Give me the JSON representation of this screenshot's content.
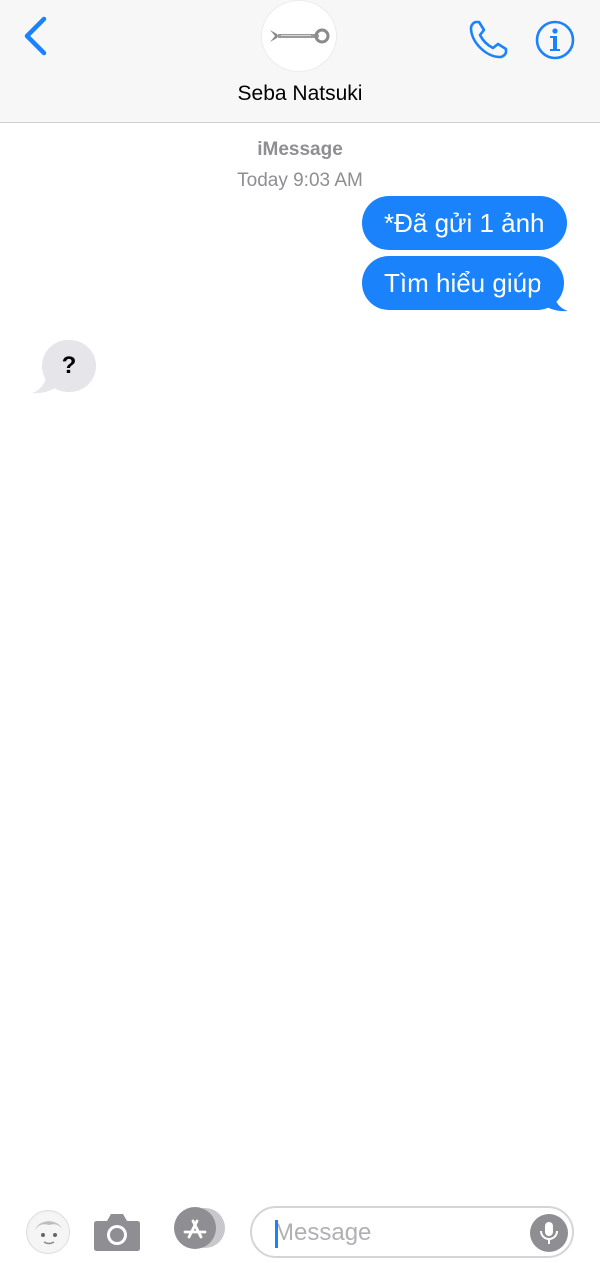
{
  "header": {
    "contact_name": "Seba Natsuki",
    "avatar_icon": "wrench-icon",
    "back_icon": "chevron-left-icon",
    "call_icon": "phone-icon",
    "info_icon": "info-icon"
  },
  "conversation": {
    "service": "iMessage",
    "timestamp": "Today 9:03 AM",
    "messages": [
      {
        "direction": "sent",
        "text": "*Đã gửi 1 ảnh"
      },
      {
        "direction": "sent",
        "text": "Tìm hiểu giúp"
      },
      {
        "direction": "received",
        "text": "?"
      }
    ]
  },
  "input_bar": {
    "placeholder": "Message",
    "memoji_icon": "memoji-avatar-icon",
    "camera_icon": "camera-icon",
    "appstore_icon": "app-store-icon",
    "mic_icon": "microphone-icon"
  },
  "colors": {
    "accent": "#1a82fb",
    "received_bubble": "#e5e5ea",
    "secondary_text": "#8e8e93"
  }
}
